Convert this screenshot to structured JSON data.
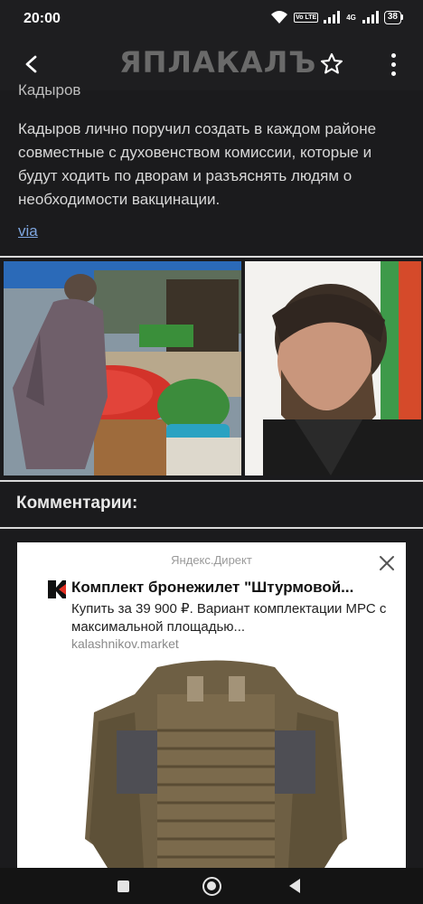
{
  "status_bar": {
    "time": "20:00",
    "tag_lte": "Vo LTE",
    "tag_4g": "4G",
    "battery": "38"
  },
  "app_bar": {
    "logo_text": "ЯПЛАКАЛЪ",
    "icons": [
      "back-arrow-icon",
      "star-icon",
      "more-vert-icon"
    ]
  },
  "article": {
    "cut_line": "Кадыров",
    "text": "Кадыров лично поручил создать в каждом районе совместные с духовенством комиссии, которые и будут ходить по дворам и разъяснять людям о необходимости вакцинации.",
    "via": "via"
  },
  "comments": {
    "title": "Комментарии:"
  },
  "ad": {
    "source": "Яндекс.Директ",
    "title": "Комплект бронежилет \"Штурмовой...",
    "description": "Купить за 39 900 ₽. Вариант комплектации МРС с максимальной площадью...",
    "domain": "kalashnikov.market"
  },
  "colors": {
    "background": "#1b1b1d",
    "link": "#7ea6e0",
    "divider": "#d9d9d9"
  }
}
